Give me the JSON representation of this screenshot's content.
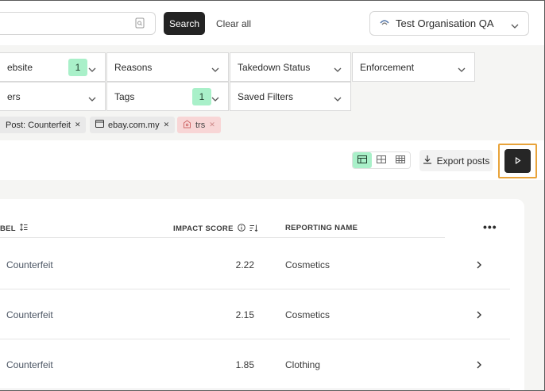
{
  "topbar": {
    "search_button": "Search",
    "clear_all": "Clear all",
    "organisation": "Test Organisation QA"
  },
  "filters": {
    "row1": [
      {
        "label": "ebsite",
        "count": "1"
      },
      {
        "label": "Reasons"
      },
      {
        "label": "Takedown Status"
      },
      {
        "label": "Enforcement"
      }
    ],
    "row2": [
      {
        "label": "ers"
      },
      {
        "label": "Tags",
        "count": "1"
      },
      {
        "label": "Saved Filters"
      }
    ],
    "chips": [
      {
        "label": "Post: Counterfeit"
      },
      {
        "label": "ebay.com.my"
      },
      {
        "label": "trs"
      }
    ]
  },
  "toolbar": {
    "export_label": "Export posts"
  },
  "table": {
    "headers": {
      "label": "BEL",
      "impact_score": "IMPACT SCORE",
      "reporting_name": "REPORTING NAME"
    },
    "rows": [
      {
        "label": "Counterfeit",
        "score": "2.22",
        "reporting_name": "Cosmetics"
      },
      {
        "label": "Counterfeit",
        "score": "2.15",
        "reporting_name": "Cosmetics"
      },
      {
        "label": "Counterfeit",
        "score": "1.85",
        "reporting_name": "Clothing"
      }
    ]
  }
}
